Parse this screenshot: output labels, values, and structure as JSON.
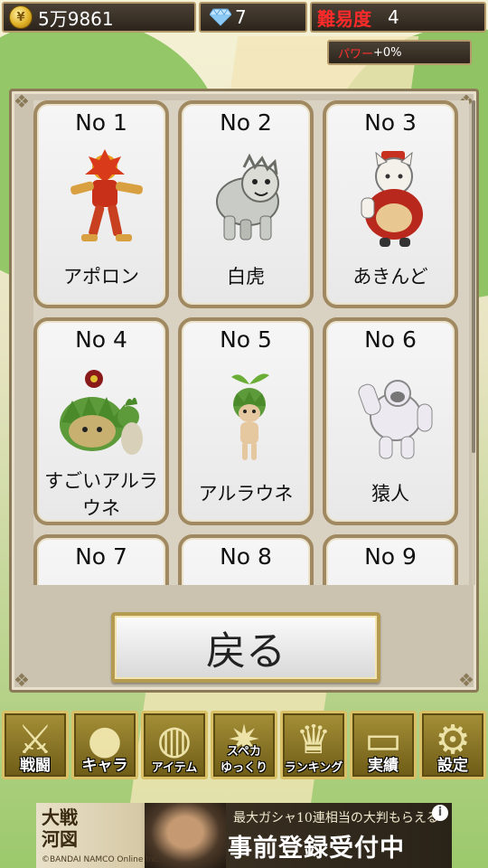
{
  "status": {
    "coins": "5万9861",
    "gems": "7",
    "difficulty_label": "難易度",
    "difficulty_value": "4",
    "power_label": "パワー",
    "power_value": "+0%"
  },
  "cards": [
    {
      "no": "No 1",
      "name": "アポロン",
      "icon": "red-armored-warrior"
    },
    {
      "no": "No 2",
      "name": "白虎",
      "icon": "white-tiger"
    },
    {
      "no": "No 3",
      "name": "あきんど",
      "icon": "merchant-cat"
    },
    {
      "no": "No 4",
      "name": "すごいアルラウネ",
      "icon": "big-alraune"
    },
    {
      "no": "No 5",
      "name": "アルラウネ",
      "icon": "alraune-sprout"
    },
    {
      "no": "No 6",
      "name": "猿人",
      "icon": "white-ape"
    },
    {
      "no": "No 7",
      "name": "",
      "icon": ""
    },
    {
      "no": "No 8",
      "name": "",
      "icon": ""
    },
    {
      "no": "No 9",
      "name": "",
      "icon": ""
    }
  ],
  "back_button": "戻る",
  "nav": [
    {
      "label": "戦闘",
      "icon": "sword-icon"
    },
    {
      "label": "キャラ",
      "icon": "person-icon"
    },
    {
      "label": "アイテム",
      "icon": "bag-icon"
    },
    {
      "label_top": "スペカ",
      "label": "ゆっくり",
      "icon": "burst-icon"
    },
    {
      "label": "ランキング",
      "icon": "trophy-icon"
    },
    {
      "label": "実績",
      "icon": "scroll-icon"
    },
    {
      "label": "設定",
      "icon": "gear-icon"
    }
  ],
  "ad": {
    "left_title_1": "大戦",
    "left_title_2": "河図",
    "copy1": "最大ガシャ10連相当の大判もらえる",
    "copy2": "事前登録受付中",
    "credit": "©BANDAI NAMCO Online Inc.",
    "info": "i"
  }
}
